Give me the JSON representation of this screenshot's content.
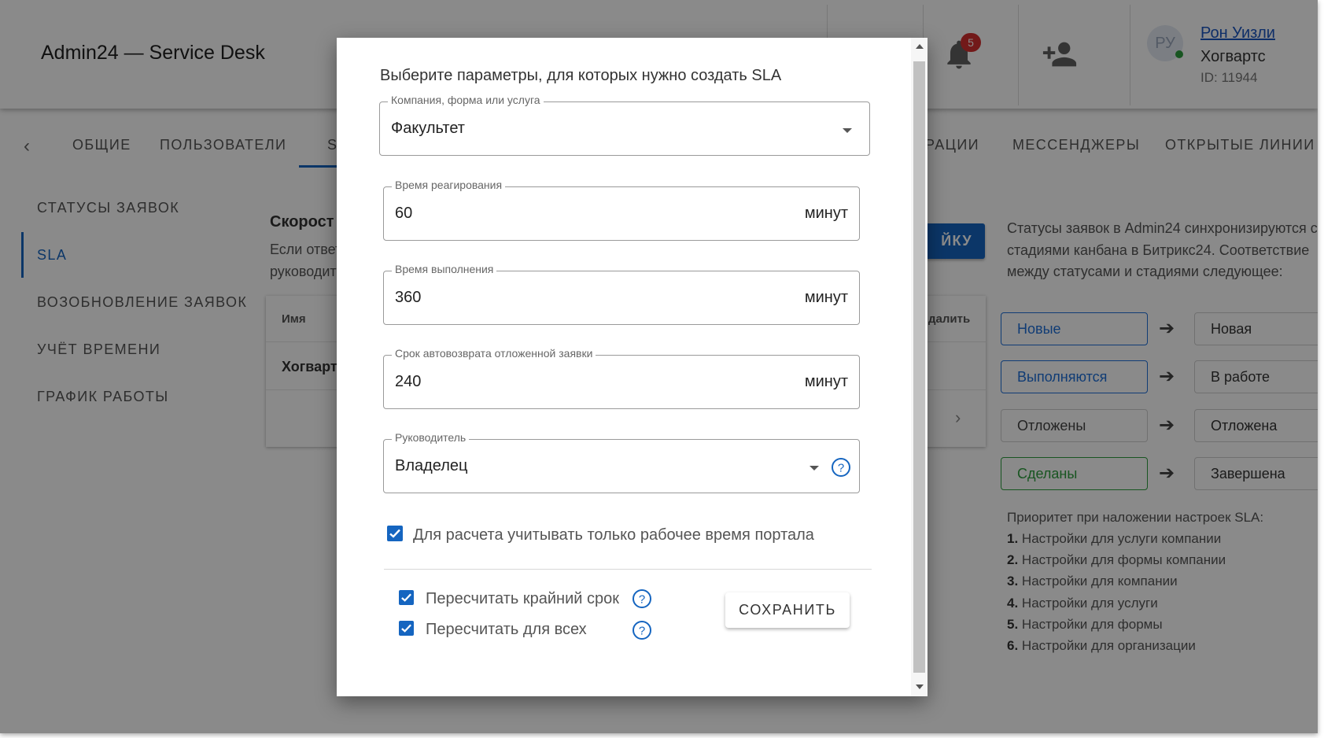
{
  "header": {
    "app_title": "Admin24 — Service Desk",
    "notification_count": "5",
    "avatar_initials": "РУ",
    "user_name": "Рон Уизли",
    "user_org": "Хогвартс",
    "user_id": "ID: 11944"
  },
  "tabs": [
    {
      "label": "ОБЩИЕ"
    },
    {
      "label": "ПОЛЬЗОВАТЕЛИ"
    },
    {
      "label": "S"
    },
    {
      "label": "РАЦИИ"
    },
    {
      "label": "МЕССЕНДЖЕРЫ"
    },
    {
      "label": "ОТКРЫТЫЕ ЛИНИИ"
    }
  ],
  "sidebar": {
    "items": [
      {
        "label": "СТАТУСЫ ЗАЯВОК"
      },
      {
        "label": "SLA"
      },
      {
        "label": "ВОЗОБНОВЛЕНИЕ ЗАЯВОК"
      },
      {
        "label": "УЧЁТ ВРЕМЕНИ"
      },
      {
        "label": "ГРАФИК РАБОТЫ"
      }
    ],
    "active": "SLA"
  },
  "main": {
    "section_title": "Скорост",
    "section_desc_1": "Если ответ",
    "section_desc_2": "руководит",
    "add_button_label": "ЙКУ",
    "table": {
      "col_name": "Имя",
      "col_delete": "далить",
      "rows": [
        {
          "name": "Хогвартс"
        }
      ]
    }
  },
  "info_panel": {
    "text": "Статусы заявок в Admin24 синхронизируются с стадиями канбана в Битрикс24. Соответствие между статусами и стадиями следующее:",
    "mappings": [
      {
        "status": "Новые",
        "stage": "Новая",
        "color": "#1e6fd9"
      },
      {
        "status": "Выполняются",
        "stage": "В работе",
        "color": "#1e6fd9"
      },
      {
        "status": "Отложены",
        "stage": "Отложена",
        "color": "#444444"
      },
      {
        "status": "Сделаны",
        "stage": "Завершена",
        "color": "#2e9e3e"
      }
    ],
    "priority_title": "Приоритет при наложении настроек SLA:",
    "priority_items": [
      {
        "num": "1.",
        "text": "Настройки для услуги компании"
      },
      {
        "num": "2.",
        "text": "Настройки для формы компании"
      },
      {
        "num": "3.",
        "text": "Настройки для компании"
      },
      {
        "num": "4.",
        "text": "Настройки для услуги"
      },
      {
        "num": "5.",
        "text": "Настройки для формы"
      },
      {
        "num": "6.",
        "text": "Настройки для организации"
      }
    ]
  },
  "dialog": {
    "title": "Выберите параметры, для которых нужно создать SLA",
    "target_field": {
      "label": "Компания, форма или услуга",
      "value": "Факультет"
    },
    "reaction_time": {
      "label": "Время реагирования",
      "value": "60",
      "unit": "минут"
    },
    "completion_time": {
      "label": "Время выполнения",
      "value": "360",
      "unit": "минут"
    },
    "auto_return": {
      "label": "Срок автовозврата отложенной заявки",
      "value": "240",
      "unit": "минут"
    },
    "supervisor": {
      "label": "Руководитель",
      "value": "Владелец"
    },
    "work_time_checkbox": {
      "label": "Для расчета учитывать только рабочее время портала",
      "checked": true
    },
    "recalc_deadline_checkbox": {
      "label": "Пересчитать крайний срок",
      "checked": true
    },
    "recalc_all_checkbox": {
      "label": "Пересчитать для всех",
      "checked": true
    },
    "save_label": "СОХРАНИТЬ"
  },
  "colors": {
    "accent": "#1565c0",
    "success": "#2e9e3e",
    "badge": "#d32f2f"
  }
}
